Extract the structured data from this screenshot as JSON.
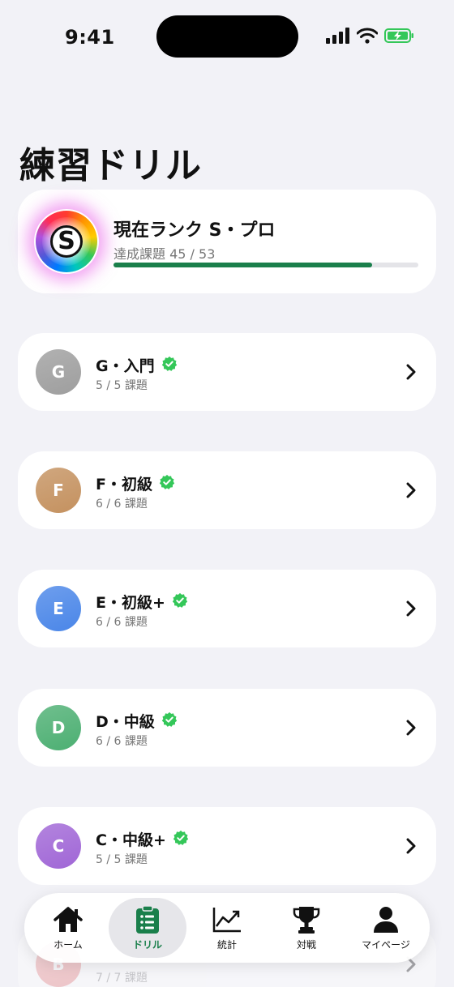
{
  "status_bar": {
    "time": "9:41",
    "icons": [
      "signal-icon",
      "wifi-icon",
      "battery-charging-icon"
    ]
  },
  "page": {
    "title": "練習ドリル"
  },
  "rank": {
    "letter": "S",
    "title": "現在ランク S・プロ",
    "progress_text": "達成課題 45 / 53",
    "completed": 45,
    "total": 53
  },
  "levels": [
    {
      "letter": "G",
      "title": "G・入門",
      "progress": "5 / 5 課題",
      "color": "#9e9e9e",
      "completed": true
    },
    {
      "letter": "F",
      "title": "F・初級",
      "progress": "6 / 6 課題",
      "color": "#c4915f",
      "completed": true
    },
    {
      "letter": "E",
      "title": "E・初級+",
      "progress": "6 / 6 課題",
      "color": "#4a86e8",
      "completed": true
    },
    {
      "letter": "D",
      "title": "D・中級",
      "progress": "6 / 6 課題",
      "color": "#4caf72",
      "completed": true
    },
    {
      "letter": "C",
      "title": "C・中級+",
      "progress": "5 / 5 課題",
      "color": "#a066d6",
      "completed": true
    },
    {
      "letter": "B",
      "title": "",
      "progress": "7 / 7 課題",
      "color": "#e57373",
      "completed": true
    }
  ],
  "tabs": [
    {
      "label": "ホーム",
      "icon": "home-icon",
      "active": false
    },
    {
      "label": "ドリル",
      "icon": "clipboard-icon",
      "active": true
    },
    {
      "label": "統計",
      "icon": "chart-icon",
      "active": false
    },
    {
      "label": "対戦",
      "icon": "trophy-icon",
      "active": false
    },
    {
      "label": "マイページ",
      "icon": "person-icon",
      "active": false
    }
  ],
  "colors": {
    "accent": "#1a7f4b",
    "verified": "#34c759",
    "background": "#f2f2f7"
  }
}
